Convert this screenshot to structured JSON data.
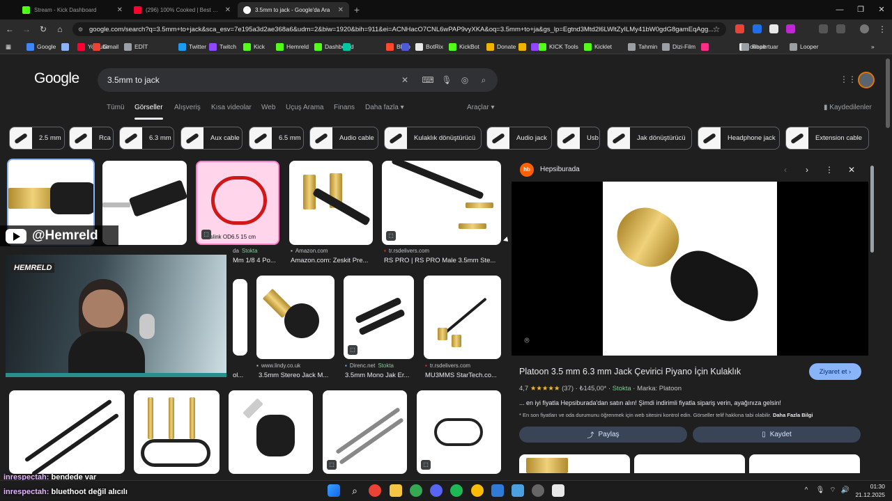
{
  "tabs": [
    {
      "label": "Stream - Kick Dashboard",
      "color": "#53fc18"
    },
    {
      "label": "(296) 100% Cooked | Best Fails",
      "color": "#ff0033"
    },
    {
      "label": "3.5mm to jack - Google'da Ara",
      "color": "#4285f4"
    }
  ],
  "address": "google.com/search?q=3.5mm+to+jack&sca_esv=7e195a3d2ae368a6&udm=2&biw=1920&bih=911&ei=ACNHacO7CNL6wPAP9vyXKA&oq=3.5mm+to+ja&gs_lp=Egtnd3Mtd2l6LWltZyILMy41bW0gdG8gamEqAgg...",
  "bookmarks": [
    {
      "label": "Google",
      "color": "#4285f4"
    },
    {
      "label": "",
      "color": "#8ab4f8"
    },
    {
      "label": "Youtube",
      "color": "#ff0033"
    },
    {
      "label": "Gmail",
      "color": "#ea4335"
    },
    {
      "label": "EDİT",
      "color": "#9aa0a6"
    },
    {
      "label": "Twitter",
      "color": "#1d9bf0"
    },
    {
      "label": "Twitch",
      "color": "#9146ff"
    },
    {
      "label": "Kick",
      "color": "#53fc18"
    },
    {
      "label": "Hemreld",
      "color": "#53fc18"
    },
    {
      "label": "Dashboard",
      "color": "#53fc18"
    },
    {
      "label": "",
      "color": "#00c8a0"
    },
    {
      "label": "Blerp",
      "color": "#ff4b2b"
    },
    {
      "label": "",
      "color": "#4f5bd5"
    },
    {
      "label": "BotRix",
      "color": "#e8e8e8"
    },
    {
      "label": "KickBot",
      "color": "#53fc18"
    },
    {
      "label": "Donate",
      "color": "#f0b400"
    },
    {
      "label": "",
      "color": "#f0b400"
    },
    {
      "label": "",
      "color": "#9146ff"
    },
    {
      "label": "KICK Tools",
      "color": "#53fc18"
    },
    {
      "label": "Kicklet",
      "color": "#53fc18"
    },
    {
      "label": "Tahmin",
      "color": "#9aa0a6"
    },
    {
      "label": "Dizi-Film",
      "color": "#9aa0a6"
    },
    {
      "label": "",
      "color": "#ff2d8a"
    },
    {
      "label": "cobalt",
      "color": "#e8e8e8"
    },
    {
      "label": "Repertuar",
      "color": "#9aa0a6"
    },
    {
      "label": "Looper",
      "color": "#9aa0a6"
    }
  ],
  "search": {
    "logo": "Google",
    "query": "3.5mm to jack"
  },
  "search_tabs": [
    "Tümü",
    "Görseller",
    "Alışveriş",
    "Kısa videolar",
    "Web",
    "Uçuş Arama",
    "Finans",
    "Daha fazla ▾"
  ],
  "tools": "Araçlar ▾",
  "saved": "Kaydedilenler",
  "chips": [
    "2.5 mm",
    "Rca",
    "6.3 mm",
    "Aux cable",
    "6.5 mm",
    "Audio cable",
    "Kulaklık dönüştürücü",
    "Audio jack",
    "Usb",
    "Jak dönüştürücü",
    "Headphone jack",
    "Extension cable"
  ],
  "results": [
    {
      "source": "da",
      "stock": "Stokta",
      "title": "Mm 1/8 4 Po..."
    },
    {
      "source": "Amazon.com",
      "stock": "",
      "title": "Amazon.com: Zeskit Pre..."
    },
    {
      "source": "tr.rsdelivers.com",
      "stock": "",
      "title": "RS PRO | RS PRO Male 3.5mm Ste..."
    },
    {
      "source": "www.lindy.co.uk",
      "stock": "",
      "title": "3.5mm Stereo Jack M..."
    },
    {
      "source": "Direnc.net",
      "stock": "Stokta",
      "title": "3.5mm Mono Jak Er..."
    },
    {
      "source": "tr.rsdelivers.com",
      "stock": "",
      "title": "MU3MMS StarTech.co..."
    },
    {
      "source": "",
      "stock": "",
      "title": "ol..."
    }
  ],
  "img_caption": "toslink OD6.5 15 cm",
  "panel": {
    "site": "Hepsiburada",
    "title": "Platoon 3.5 mm 6.3 mm Jack Çevirici Piyano İçin Kulaklık",
    "visit": "Ziyaret et",
    "rating": "4,7",
    "stars": "★★★★★",
    "reviews": "(37)",
    "price": "₺145,00*",
    "stock": "Stokta",
    "brand": "Marka: Platoon",
    "desc": "... en iyi fiyatla Hepsiburada'dan satın alın! Şimdi indirimli fiyatla sipariş verin, ayağınıza gelsin!",
    "note": "* En son fiyatları ve oda durumunu öğrenmek için web sitesini kontrol edin. Görseller telif hakkına tabi olabilir.",
    "more": "Daha Fazla Bilgi",
    "share": "Paylaş",
    "save": "Kaydet"
  },
  "overlay": {
    "handle": "@Hemreld",
    "cam_logo": "HEMRELD"
  },
  "chat": [
    {
      "user": "inrespectah:",
      "msg": "bendede var"
    },
    {
      "user": "inrespectah:",
      "msg": "bluethoot değil alıcılı"
    }
  ],
  "clock": {
    "time": "01:30",
    "date": "21.12.2025"
  }
}
